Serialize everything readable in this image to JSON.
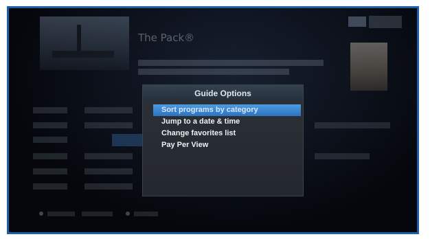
{
  "dialog": {
    "title": "Guide Options",
    "items": [
      {
        "label": "Sort programs by category",
        "selected": true
      },
      {
        "label": "Jump to a date & time",
        "selected": false
      },
      {
        "label": "Change favorites list",
        "selected": false
      },
      {
        "label": "Pay Per View",
        "selected": false
      }
    ]
  },
  "background": {
    "show_title": "The Pack®",
    "colors": {
      "frame_border": "#1a5fa8",
      "selection": "#3a86d0",
      "dialog_bg": "#2a2e34"
    }
  }
}
